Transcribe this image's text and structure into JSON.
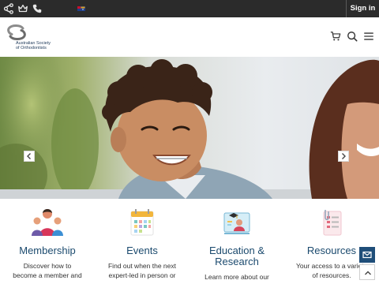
{
  "topbar": {
    "icons": [
      "share-icon",
      "crown-icon",
      "phone-icon"
    ],
    "signin_label": "Sign in"
  },
  "header": {
    "logo_text_line1": "Australian Society",
    "logo_text_line2": "of Orthodontists",
    "icons": [
      "cart-icon",
      "search-icon",
      "menu-icon"
    ]
  },
  "hero": {
    "prev_icon": "chevron-left-icon",
    "next_icon": "chevron-right-icon"
  },
  "categories": [
    {
      "title": "Membership",
      "desc_line1": "Discover how to",
      "desc_line2": "become a member and",
      "icon": "people-icon"
    },
    {
      "title": "Events",
      "desc_line1": "Find out when the next",
      "desc_line2": "expert-led in person or",
      "icon": "calendar-icon"
    },
    {
      "title_line1": "Education &",
      "title_line2": "Research",
      "desc_line1": "Learn more about our",
      "icon": "education-icon"
    },
    {
      "title": "Resources",
      "desc_line1": "Your access to a variety",
      "desc_line2": "of resources.",
      "icon": "clipboard-icon"
    }
  ],
  "side_buttons": [
    "mail-icon",
    "chevron-up-icon"
  ],
  "colors": {
    "topbar": "#2b2b2b",
    "heading": "#1b4a6e",
    "mail_button": "#1f4e79"
  }
}
